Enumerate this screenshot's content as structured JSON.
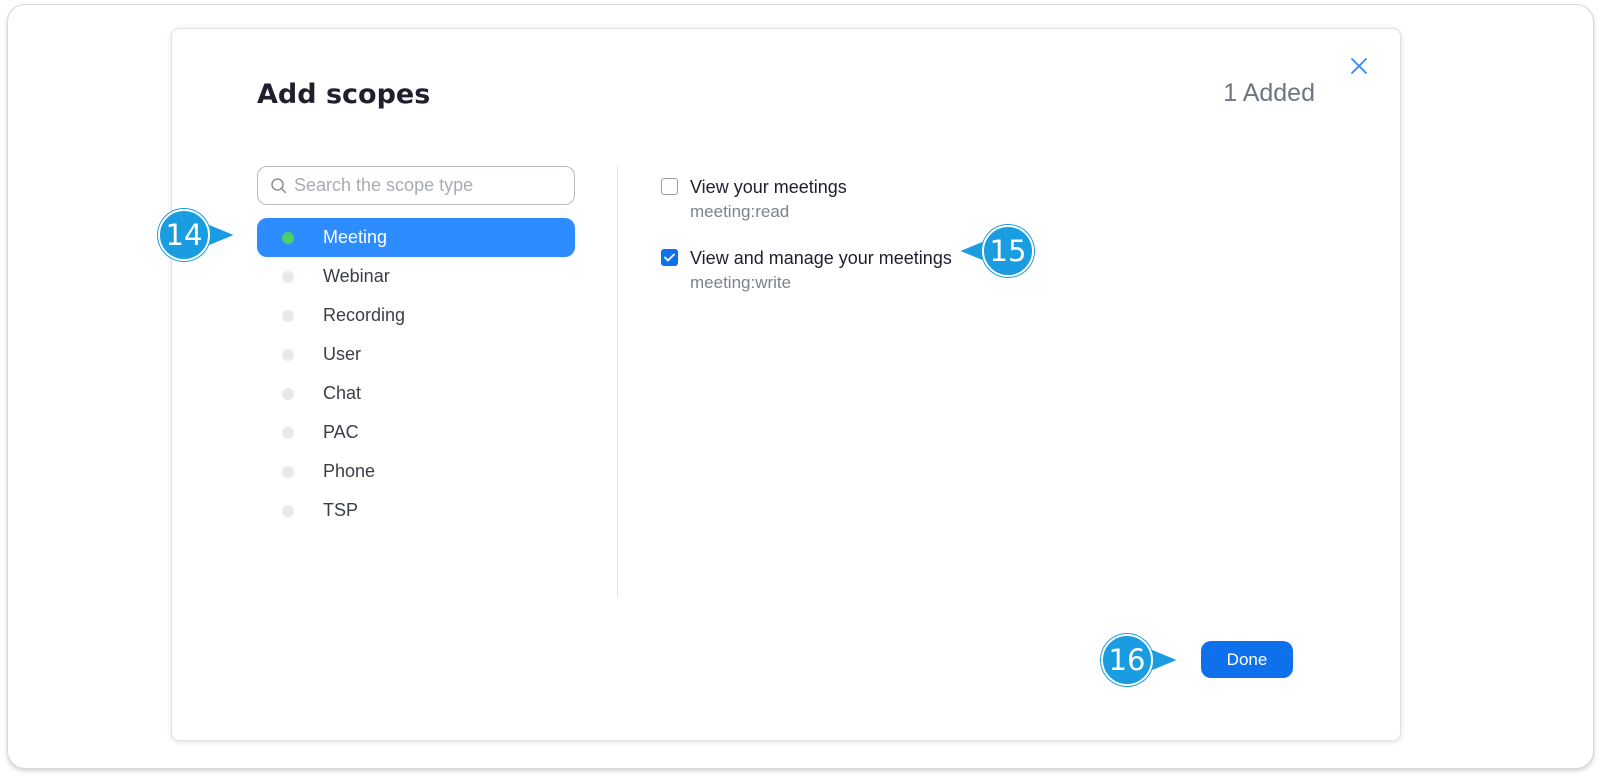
{
  "dialog": {
    "title": "Add scopes",
    "added_count": "1 Added",
    "close_icon": "close-icon"
  },
  "search": {
    "placeholder": "Search the scope type",
    "icon": "search-icon"
  },
  "scope_types": [
    {
      "label": "Meeting",
      "active": true
    },
    {
      "label": "Webinar",
      "active": false
    },
    {
      "label": "Recording",
      "active": false
    },
    {
      "label": "User",
      "active": false
    },
    {
      "label": "Chat",
      "active": false
    },
    {
      "label": "PAC",
      "active": false
    },
    {
      "label": "Phone",
      "active": false
    },
    {
      "label": "TSP",
      "active": false
    }
  ],
  "permissions": [
    {
      "title": "View your meetings",
      "code": "meeting:read",
      "checked": false
    },
    {
      "title": "View and manage your meetings",
      "code": "meeting:write",
      "checked": true
    }
  ],
  "footer": {
    "done_label": "Done"
  },
  "callouts": {
    "c14": "14",
    "c15": "15",
    "c16": "16"
  },
  "colors": {
    "accent": "#2d8cff",
    "primary_button": "#0e71eb",
    "active_dot": "#4cd06a",
    "callout": "#1a9ce0"
  }
}
